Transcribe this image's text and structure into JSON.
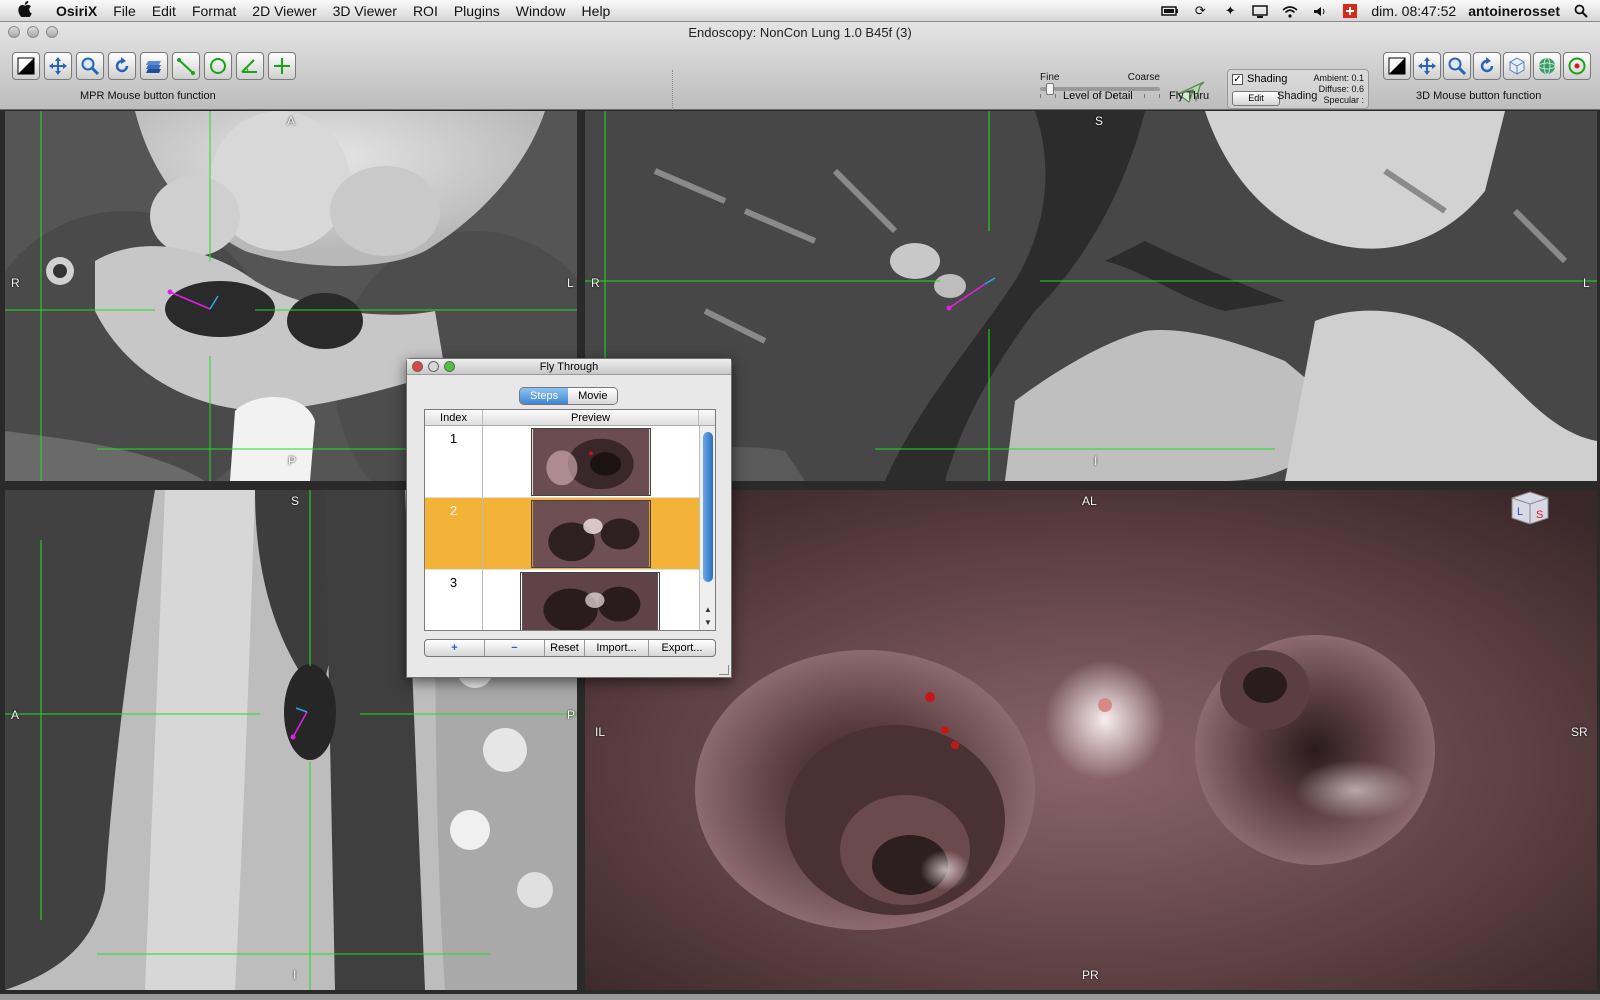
{
  "menubar": {
    "app": "OsiriX",
    "items": [
      "File",
      "Edit",
      "Format",
      "2D Viewer",
      "3D Viewer",
      "ROI",
      "Plugins",
      "Window",
      "Help"
    ],
    "clock": "dim. 08:47:52",
    "user": "antoinerosset"
  },
  "window": {
    "title": "Endoscopy: NonCon Lung  1.0  B45f (3)"
  },
  "toolbar": {
    "mpr_label": "MPR Mouse button function",
    "mpr_tools": [
      "wl-icon",
      "move-icon",
      "zoom-icon",
      "rotate-icon",
      "stack-icon",
      "length-icon",
      "oval-icon",
      "angle-icon",
      "point-icon"
    ],
    "lod": {
      "fine": "Fine",
      "coarse": "Coarse",
      "label": "Level of Detail",
      "value": 0.05
    },
    "fly_thru_label": "Fly Thru",
    "shading": {
      "checkbox": "Shading",
      "checked": true,
      "edit": "Edit",
      "ambient": "Ambient: 0.1",
      "diffuse": "Diffuse: 0.6",
      "specular": "Specular :",
      "label": "Shading"
    },
    "vr_label": "3D Mouse button function",
    "vr_tools": [
      "wl-icon",
      "move-icon",
      "zoom-icon",
      "rotate-icon",
      "camera-icon",
      "sphere-icon",
      "target-icon"
    ]
  },
  "viewports": {
    "axial": {
      "top": "A",
      "bottom": "P",
      "left": "R",
      "right": "L"
    },
    "coronal": {
      "top": "S",
      "bottom": "I",
      "left": "R",
      "right": "L"
    },
    "sagittal": {
      "top": "S",
      "bottom": "I",
      "left": "A",
      "right": "P"
    },
    "endoscopy": {
      "top": "AL",
      "bottom": "PR",
      "left": "IL",
      "right": "SR"
    }
  },
  "fly_through": {
    "title": "Fly Through",
    "tabs": [
      "Steps",
      "Movie"
    ],
    "selected_tab": "Steps",
    "columns": [
      "Index",
      "Preview"
    ],
    "rows": [
      {
        "index": "1",
        "selected": false
      },
      {
        "index": "2",
        "selected": true
      },
      {
        "index": "3",
        "selected": false
      }
    ],
    "buttons": {
      "add": "+",
      "remove": "−",
      "reset": "Reset",
      "import": "Import...",
      "export": "Export..."
    }
  },
  "colors": {
    "crosshair": "#22dd22",
    "selection": "#f2b338",
    "endoscopy_tissue": "#6d4b4e"
  }
}
